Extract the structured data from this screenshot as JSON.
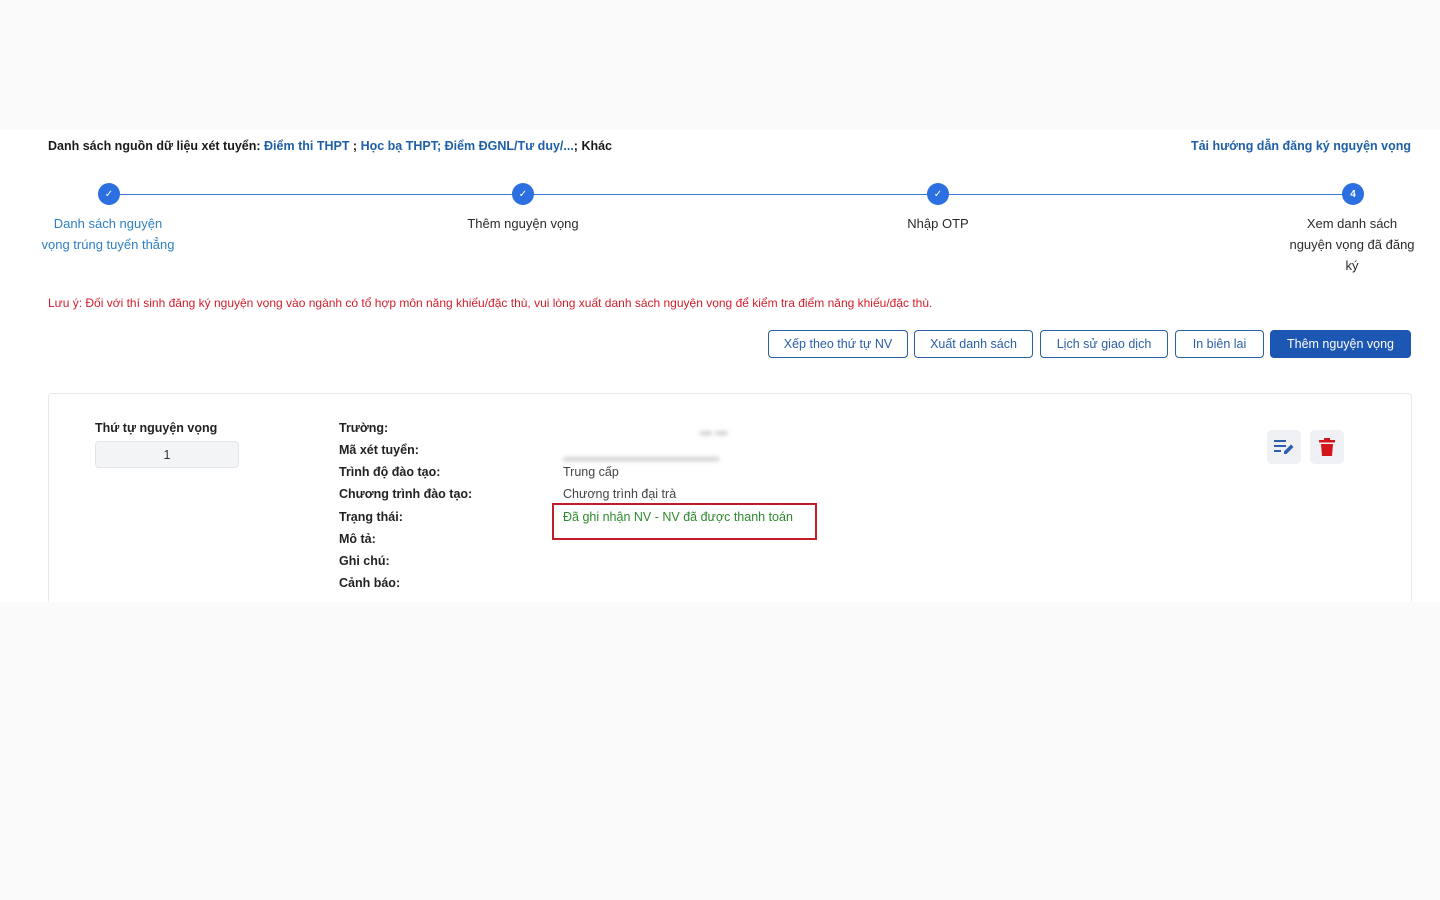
{
  "header": {
    "sources_prefix": "Danh sách nguồn dữ liệu xét tuyển:",
    "source_thpt": "Điểm thi THPT",
    "sep1": " ; ",
    "source_hocba": "Học bạ THPT; Điểm ĐGNL/Tư duy/...",
    "sep2": "; ",
    "source_other": "Khác",
    "guide_link": "Tải hướng dẫn đăng ký nguyện vọng"
  },
  "stepper": {
    "steps": [
      {
        "label": "Danh sách nguyện vọng trúng tuyển thẳng",
        "state": "done"
      },
      {
        "label": "Thêm nguyện vọng",
        "state": "done"
      },
      {
        "label": "Nhập OTP",
        "state": "done"
      },
      {
        "label": "Xem danh sách nguyện vọng đã đăng ký",
        "state": "current",
        "number": "4"
      }
    ],
    "check_glyph": "✓"
  },
  "note": "Lưu ý: Đối với thí sinh đăng ký nguyện vọng vào ngành có tổ hợp môn năng khiếu/đặc thù, vui lòng xuất danh sách nguyện vọng để kiểm tra điểm năng khiếu/đặc thù.",
  "actions": {
    "sort": "Xếp theo thứ tự NV",
    "export": "Xuất danh sách",
    "history": "Lịch sử giao dịch",
    "print": "In biên lai",
    "add": "Thêm nguyện vọng"
  },
  "card": {
    "order_label": "Thứ tự nguyện vọng",
    "order_value": "1",
    "fields": {
      "school_label": "Trường:",
      "code_label": "Mã xét tuyển:",
      "level_label": "Trình độ đào tạo:",
      "level_value": "Trung cấp",
      "program_label": "Chương trình đào tạo:",
      "program_value": "Chương trình đại trà",
      "status_label": "Trạng thái:",
      "status_value": "Đã ghi nhận NV - NV đã được thanh toán",
      "desc_label": "Mô tả:",
      "note_label": "Ghi chú:",
      "warning_label": "Cảnh báo:"
    }
  },
  "colors": {
    "accent": "#1c57b4",
    "link": "#1f5fa8",
    "status_green": "#2e8b2e",
    "note_red": "#d21f2b",
    "highlight_red": "#c41d2a",
    "delete_red": "#d3161b"
  },
  "icons": {
    "edit": "edit-list-icon",
    "delete": "trash-icon"
  }
}
